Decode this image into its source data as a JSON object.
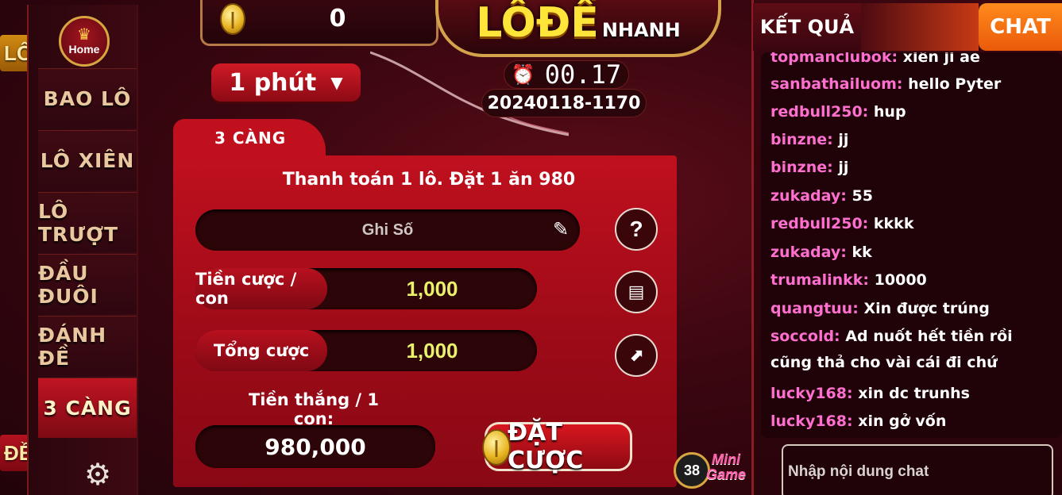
{
  "side_tabs": {
    "lo": "LÔ",
    "de": "ĐỀ"
  },
  "home": {
    "label": "Home"
  },
  "menu": [
    {
      "label": "BAO LÔ",
      "active": false
    },
    {
      "label": "LÔ XIÊN",
      "active": false
    },
    {
      "label": "LÔ TRƯỢT",
      "active": false
    },
    {
      "label": "ĐẦU ĐUÔI",
      "active": false
    },
    {
      "label": "ĐÁNH ĐỀ",
      "active": false
    },
    {
      "label": "3 CÀNG",
      "active": true
    }
  ],
  "balance": {
    "amount": "0"
  },
  "logo": {
    "main": "LÔĐỀ",
    "sub": "NHANH"
  },
  "time_select": {
    "value": "1 phút"
  },
  "timer": {
    "countdown": "00.17",
    "round_id": "20240118-1170"
  },
  "panel": {
    "tab": "3 CÀNG",
    "payout_info": "Thanh toán 1 lô. Đặt 1 ăn 980",
    "number_placeholder": "Ghi Số",
    "stake_label": "Tiền cược / con",
    "stake_value": "1,000",
    "total_label": "Tổng cược",
    "total_value": "1,000",
    "win_label": "Tiền thắng / 1 con:",
    "win_value": "980,000",
    "place_bet": "ĐẶT CƯỢC"
  },
  "mini_game": {
    "badge": "38",
    "text_line1": "Mini",
    "text_line2": "Game"
  },
  "chat": {
    "tab_result": "KẾT QUẢ",
    "tab_chat": "CHAT",
    "messages": [
      {
        "user": "topmanclubok:",
        "text": "xiên ji ae"
      },
      {
        "user": "sanbathailuom:",
        "text": "hello Pyter"
      },
      {
        "user": "redbull250:",
        "text": "hup"
      },
      {
        "user": "binzne:",
        "text": "jj"
      },
      {
        "user": "binzne:",
        "text": "jj"
      },
      {
        "user": "zukaday:",
        "text": "55"
      },
      {
        "user": "redbull250:",
        "text": "kkkk"
      },
      {
        "user": "zukaday:",
        "text": "kk"
      },
      {
        "user": "trumalinkk:",
        "text": "10000"
      },
      {
        "user": "quangtuu:",
        "text": "Xin được trúng"
      },
      {
        "user": "soccold:",
        "text": "Ad nuốt hết tiền rồi cũng thả cho vài cái đi chứ"
      },
      {
        "user": "lucky168:",
        "text": "xin dc trunhs"
      },
      {
        "user": "lucky168:",
        "text": "xin gở vốn"
      }
    ],
    "input_placeholder": "Nhập nội dung chat"
  }
}
